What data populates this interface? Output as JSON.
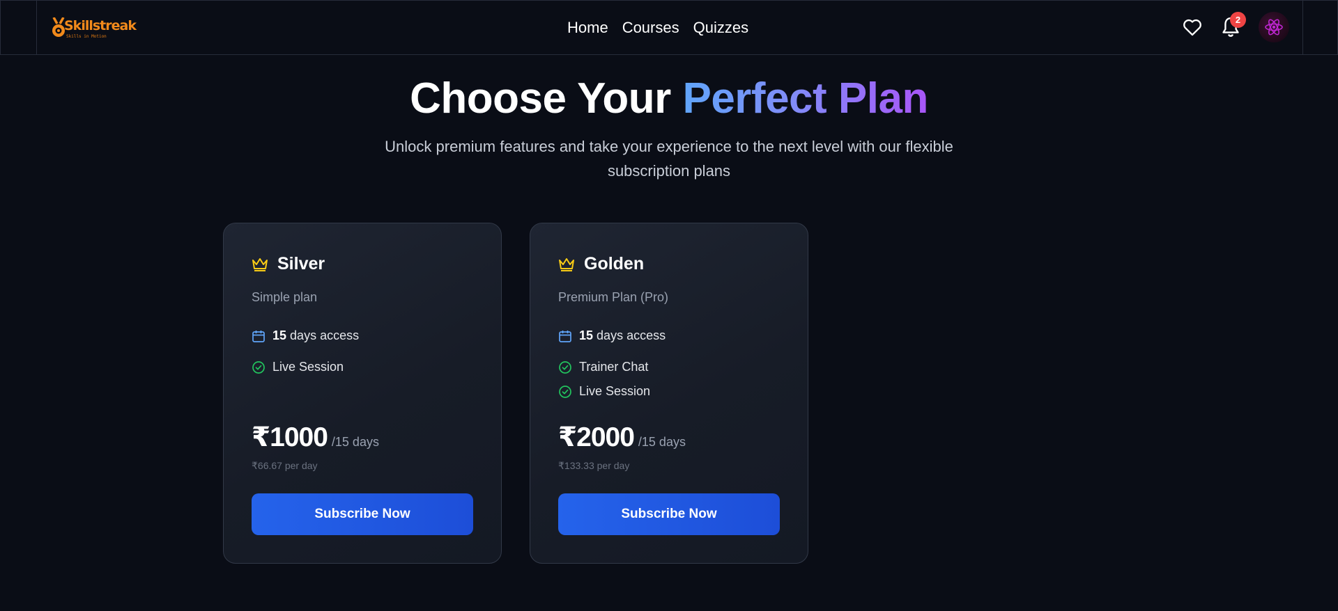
{
  "nav": {
    "brand": "Skillstreak",
    "tagline": "Skills in Motion",
    "links": [
      "Home",
      "Courses",
      "Quizzes"
    ],
    "notification_count": "2"
  },
  "hero": {
    "title_plain": "Choose Your",
    "title_highlight": "Perfect Plan",
    "subtitle": "Unlock premium features and take your experience to the next level with our flexible subscription plans"
  },
  "plans": [
    {
      "name": "Silver",
      "description": "Simple plan",
      "access_days": "15",
      "access_suffix": "days access",
      "features": [
        "Live Session"
      ],
      "price": "₹1000",
      "period": "/15 days",
      "per_day": "₹66.67 per day",
      "cta": "Subscribe Now"
    },
    {
      "name": "Golden",
      "description": "Premium Plan (Pro)",
      "access_days": "15",
      "access_suffix": "days access",
      "features": [
        "Trainer Chat",
        "Live Session"
      ],
      "price": "₹2000",
      "period": "/15 days",
      "per_day": "₹133.33 per day",
      "cta": "Subscribe Now"
    }
  ],
  "colors": {
    "background": "#0a0d16",
    "accent_blue": "#2563eb",
    "crown": "#facc15",
    "check": "#22c55e",
    "calendar": "#60a5fa",
    "badge": "#ef4444",
    "brand": "#f28a1b"
  },
  "icons": {
    "plan": "crown-icon",
    "access": "calendar-icon",
    "feature": "check-circle-icon",
    "wishlist": "heart-icon",
    "notifications": "bell-icon",
    "avatar": "atom-icon"
  }
}
